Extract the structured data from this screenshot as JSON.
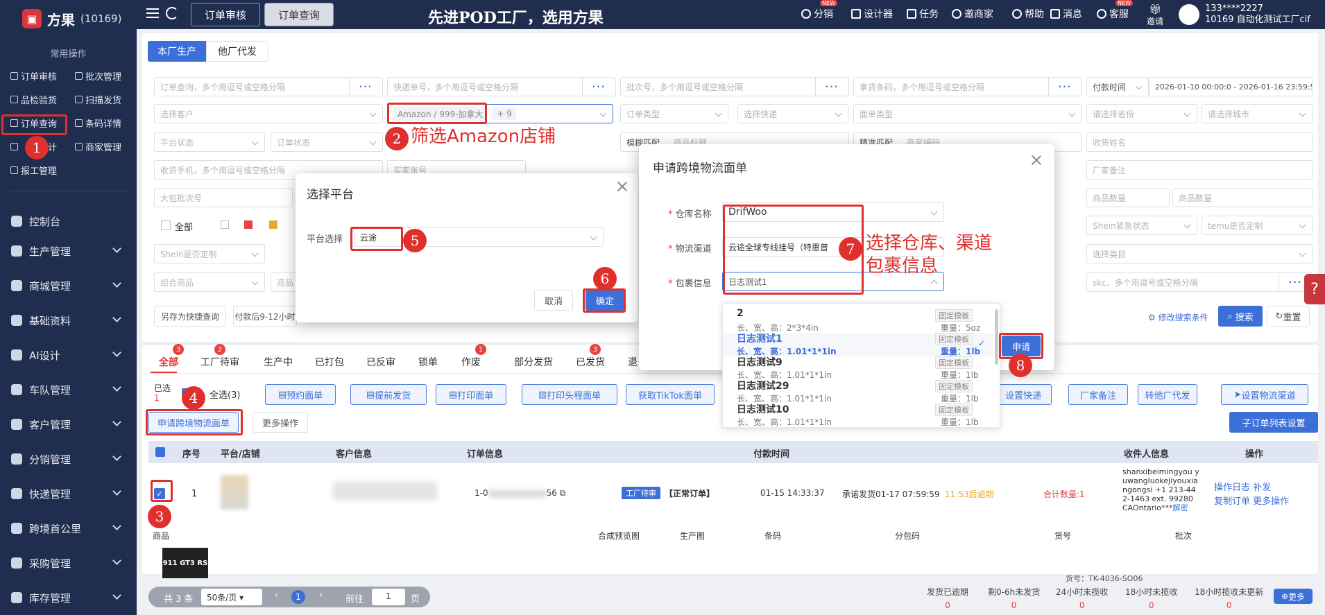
{
  "app": {
    "name": "方果",
    "count": "(10169)",
    "banner": "先进POD工厂，选用方果"
  },
  "sidebar": {
    "section_title": "常用操作",
    "quick": [
      "订单审核",
      "批次管理",
      "品检验货",
      "扫描发货",
      "订单查询",
      "条码详情",
      "统计",
      "商家管理",
      "报工管理"
    ],
    "menu": [
      "控制台",
      "生产管理",
      "商城管理",
      "基础资料",
      "AI设计",
      "车队管理",
      "客户管理",
      "分销管理",
      "快递管理",
      "跨境首公里",
      "采购管理",
      "库存管理"
    ]
  },
  "header": {
    "tabs": [
      "订单审核",
      "订单查询"
    ],
    "items": [
      "分销",
      "设计器",
      "任务",
      "邀商家",
      "帮助",
      "消息",
      "客服",
      "邀请"
    ],
    "user_phone": "133****2227",
    "user_name": "10169 自动化测试工厂cif"
  },
  "top_tabs": [
    "本厂生产",
    "他厂代发"
  ],
  "filters": {
    "row1": [
      "订单查询，多个用逗号或空格分隔",
      "快递单号，多个用逗号或空格分隔",
      "批次号，多个用逗号或空格分隔",
      "拿货条码，多个用逗号或空格分隔",
      "付款时间",
      "2026-01-10 00:00:0 - 2026-01-16 23:59:5"
    ],
    "row2": [
      "选择客户",
      "Amazon / 999-加拿大",
      "+ 9",
      "订单类型",
      "选择快递",
      "面单类型",
      "请选择省份",
      "请选择城市"
    ],
    "row3": [
      "平台状态",
      "订单状态",
      "模糊匹配",
      "商品标题",
      "精准匹配",
      "商家编码",
      "收货姓名"
    ],
    "row4": [
      "收货手机，多个用逗号或空格分隔",
      "买家账号",
      "厂家备注"
    ],
    "row5": [
      "大包批次号",
      "商品数量",
      "商品数量"
    ],
    "row6_all": "全部",
    "row6": [
      "Shein紧急状态",
      "temu是否定制"
    ],
    "row7": [
      "Shein是否定制",
      "选择类目"
    ],
    "row8": [
      "组合商品",
      "商品",
      "skc，多个用逗号或空格分隔"
    ],
    "actions": [
      "另存为快捷查询",
      "付款后9-12小时",
      "修改搜索条件",
      "搜索",
      "重置"
    ]
  },
  "status_tabs": [
    {
      "label": "全部",
      "badge": "3"
    },
    {
      "label": "工厂待审",
      "badge": "2"
    },
    {
      "label": "生产中",
      "badge": ""
    },
    {
      "label": "已打包",
      "badge": ""
    },
    {
      "label": "已反审",
      "badge": ""
    },
    {
      "label": "锁单",
      "badge": ""
    },
    {
      "label": "作废",
      "badge": "1"
    },
    {
      "label": "部分发货",
      "badge": ""
    },
    {
      "label": "已发货",
      "badge": "3"
    },
    {
      "label": "退",
      "badge": ""
    }
  ],
  "toolbar": {
    "selected_label": "已选",
    "selected_count": "1",
    "select_all": "全选(3)",
    "buttons": [
      "预约面单",
      "提前发货",
      "打印面单",
      "打印头程面单",
      "获取TikTok面单"
    ],
    "right_buttons": [
      "设置快递",
      "厂家备注",
      "转他厂代发",
      "设置物流渠道"
    ],
    "apply_btn": "申请跨境物流面单",
    "more_ops": "更多操作",
    "sub_list": "子订单列表设置"
  },
  "table": {
    "headers": [
      "序号",
      "平台/店铺",
      "客户信息",
      "订单信息",
      "付款时间",
      "收件人信息",
      "操作"
    ],
    "row": {
      "index": "1",
      "order_no_prefix": "1-0",
      "order_no_suffix": "56",
      "status": "工厂待审",
      "type": "【正常订单】",
      "pay_time": "01-15 14:33:37",
      "promise": "承诺发货01-17 07:59:59",
      "overdue": "11:53后逾期",
      "total": "合计数量:1",
      "recipient": "shanxibeimingyou yuwangluokejiyouxiangongsi +1 213-442-1463 ext. 99280 CAOntario***",
      "recipient_link": "解密",
      "ops": [
        "操作日志",
        "补发",
        "复制订单",
        "更多操作"
      ]
    },
    "sub_headers": [
      "商品",
      "合成预览图",
      "生产图",
      "条码",
      "分包码",
      "货号",
      "批次"
    ],
    "sku": "货号：TK-4036-SO06",
    "thumb_text": "911 GT3 RS"
  },
  "pagination": {
    "total": "共 3 条",
    "page_size": "50条/页",
    "current": "1",
    "goto": "前往",
    "goto_val": "1",
    "page_unit": "页"
  },
  "bottom_stats": [
    {
      "label": "发货已逾期",
      "value": "0"
    },
    {
      "label": "剩0-6h未发货",
      "value": "0"
    },
    {
      "label": "24小时未揽收",
      "value": "0"
    },
    {
      "label": "18小时未揽收",
      "value": "0"
    },
    {
      "label": "18小时揽收未更新",
      "value": "0"
    }
  ],
  "more_btn": "更多",
  "platform_modal": {
    "title": "选择平台",
    "field_label": "平台选择",
    "value": "云途",
    "cancel": "取消",
    "confirm": "确定"
  },
  "logistics_modal": {
    "title": "申请跨境物流面单",
    "warehouse_label": "仓库名称",
    "warehouse_value": "DrifWoo",
    "channel_label": "物流渠道",
    "channel_value": "云途全球专线挂号（特惠普",
    "package_label": "包裹信息",
    "package_value": "日志测试1",
    "submit": "申请",
    "options": [
      {
        "name": "2",
        "tag": "固定模板",
        "dims": "长、宽、高：2*3*4in",
        "weight": "重量：5oz",
        "selected": false
      },
      {
        "name": "日志测试1",
        "tag": "固定模板",
        "dims": "长、宽、高：1.01*1*1in",
        "weight": "重量：1lb",
        "selected": true
      },
      {
        "name": "日志测试9",
        "tag": "固定模板",
        "dims": "长、宽、高：1.01*1*1in",
        "weight": "重量：1lb",
        "selected": false
      },
      {
        "name": "日志测试29",
        "tag": "固定模板",
        "dims": "长、宽、高：1.01*1*1in",
        "weight": "重量：1lb",
        "selected": false
      },
      {
        "name": "日志测试10",
        "tag": "固定模板",
        "dims": "长、宽、高：1.01*1*1in",
        "weight": "重量：1lb",
        "selected": false
      }
    ]
  },
  "annotations": {
    "step_numbers": [
      "1",
      "2",
      "3",
      "4",
      "5",
      "6",
      "7",
      "8"
    ],
    "text2": "筛选Amazon店铺",
    "text7_line1": "选择仓库、渠道",
    "text7_line2": "包裹信息"
  }
}
